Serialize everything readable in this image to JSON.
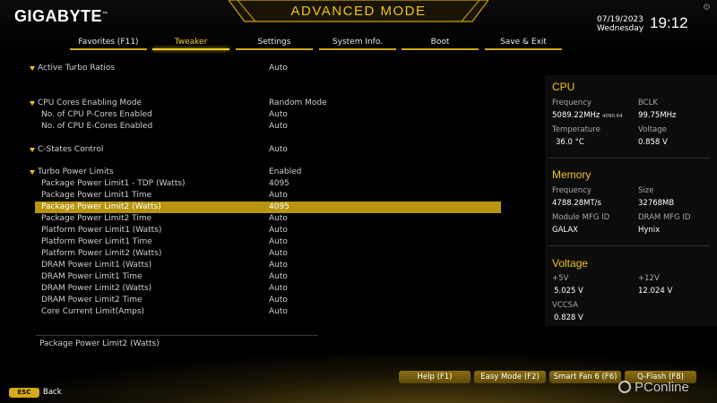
{
  "brand": {
    "name": "GIGABYTE",
    "mark": "™"
  },
  "mode_title": "ADVANCED MODE",
  "datetime": {
    "date": "07/19/2023",
    "weekday": "Wednesday",
    "time": "19:12"
  },
  "tabs": [
    {
      "label": "Favorites (F11)",
      "active": false
    },
    {
      "label": "Tweaker",
      "active": true
    },
    {
      "label": "Settings",
      "active": false
    },
    {
      "label": "System Info.",
      "active": false
    },
    {
      "label": "Boot",
      "active": false
    },
    {
      "label": "Save & Exit",
      "active": false
    }
  ],
  "settings": [
    {
      "label": "Active Turbo Ratios",
      "value": "Auto",
      "type": "head"
    },
    {
      "label": "CPU Cores Enabling Mode",
      "value": "Random Mode",
      "type": "head"
    },
    {
      "label": "No. of CPU P-Cores Enabled",
      "value": "Auto",
      "type": "sub"
    },
    {
      "label": "No. of CPU E-Cores Enabled",
      "value": "Auto",
      "type": "sub"
    },
    {
      "label": "C-States Control",
      "value": "Auto",
      "type": "head"
    },
    {
      "label": "Turbo Power Limits",
      "value": "Enabled",
      "type": "head"
    },
    {
      "label": "Package Power Limit1 - TDP (Watts)",
      "value": "4095",
      "type": "sub"
    },
    {
      "label": "Package Power Limit1 Time",
      "value": "Auto",
      "type": "sub"
    },
    {
      "label": "Package Power Limit2 (Watts)",
      "value": "4095",
      "type": "selected"
    },
    {
      "label": "Package Power Limit2 Time",
      "value": "Auto",
      "type": "sub"
    },
    {
      "label": "Platform Power Limit1 (Watts)",
      "value": "Auto",
      "type": "sub"
    },
    {
      "label": "Platform Power Limit1 Time",
      "value": "Auto",
      "type": "sub"
    },
    {
      "label": "Platform Power Limit2 (Watts)",
      "value": "Auto",
      "type": "sub"
    },
    {
      "label": "DRAM Power Limit1 (Watts)",
      "value": "Auto",
      "type": "sub"
    },
    {
      "label": "DRAM Power Limit1 Time",
      "value": "Auto",
      "type": "sub"
    },
    {
      "label": "DRAM Power Limit2 (Watts)",
      "value": "Auto",
      "type": "sub"
    },
    {
      "label": "DRAM Power Limit2 Time",
      "value": "Auto",
      "type": "sub"
    },
    {
      "label": "Core Current Limit(Amps)",
      "value": "Auto",
      "type": "sub"
    }
  ],
  "help_text": "Package Power Limit2 (Watts)",
  "panel": {
    "cpu": {
      "title": "CPU",
      "frequency_label": "Frequency",
      "frequency_value": "5089.22MHz",
      "frequency_sub": "4090.64",
      "bclk_label": "BCLK",
      "bclk_value": "99.75MHz",
      "temperature_label": "Temperature",
      "temperature_value": "36.0 °C",
      "voltage_label": "Voltage",
      "voltage_value": "0.858 V"
    },
    "memory": {
      "title": "Memory",
      "frequency_label": "Frequency",
      "frequency_value": "4788.28MT/s",
      "size_label": "Size",
      "size_value": "32768MB",
      "module_mfg_label": "Module MFG ID",
      "module_mfg_value": "GALAX",
      "dram_mfg_label": "DRAM MFG ID",
      "dram_mfg_value": "Hynix"
    },
    "voltage": {
      "title": "Voltage",
      "v5_label": "+5V",
      "v5_value": "5.025 V",
      "v12_label": "+12V",
      "v12_value": "12.024 V",
      "vccsa_label": "VCCSA",
      "vccsa_value": "0.828 V"
    }
  },
  "function_buttons": [
    {
      "label": "Help (F1)"
    },
    {
      "label": "Easy Mode (F2)"
    },
    {
      "label": "Smart Fan 6 (F6)"
    },
    {
      "label": "Q-Flash (F8)"
    }
  ],
  "esc": {
    "key": "ESC",
    "label": "Back"
  },
  "watermark": "PConline",
  "colors": {
    "accent": "#f0c419",
    "selected_row": "#b7950e",
    "background": "#000000"
  }
}
